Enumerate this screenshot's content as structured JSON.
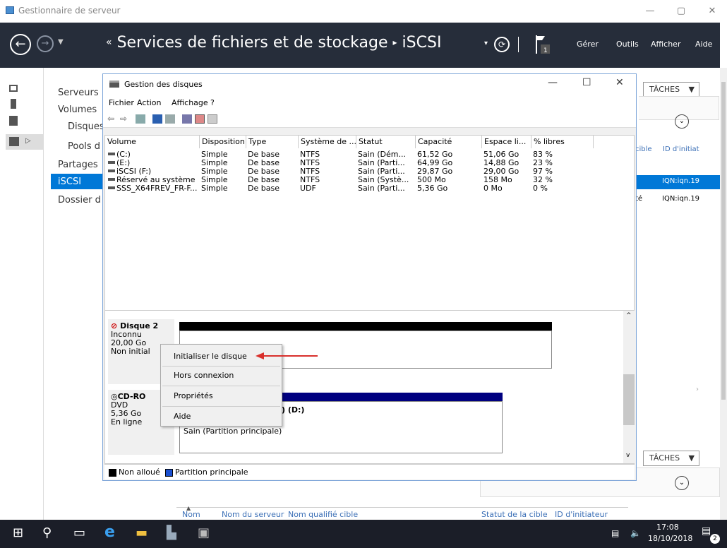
{
  "window": {
    "title": "Gestionnaire de serveur"
  },
  "header": {
    "breadcrumb_prefix": "«",
    "title": "Services de fichiers et de stockage",
    "sep": "▸",
    "page": "iSCSI",
    "menu": [
      "Gérer",
      "Outils",
      "Afficher",
      "Aide"
    ]
  },
  "nav": [
    "Serveurs",
    "Volumes",
    "Disques",
    "Pools d",
    "Partages",
    "iSCSI",
    "Dossier d"
  ],
  "right": {
    "taches": "TÂCHES",
    "col_cible": "cible",
    "col_initiateur": "ID d'initiat",
    "row1": "IQN:iqn.19",
    "row2_state": "té",
    "row2": "IQN:iqn.19"
  },
  "dm": {
    "title": "Gestion des disques",
    "menu": [
      "Fichier",
      "Action",
      "Affichage",
      "?"
    ],
    "columns": [
      "Volume",
      "Disposition",
      "Type",
      "Système de ...",
      "Statut",
      "Capacité",
      "Espace li...",
      "% libres"
    ],
    "rows": [
      [
        "(C:)",
        "Simple",
        "De base",
        "NTFS",
        "Sain (Dém...",
        "61,52 Go",
        "51,06 Go",
        "83 %"
      ],
      [
        "(E:)",
        "Simple",
        "De base",
        "NTFS",
        "Sain (Parti...",
        "64,99 Go",
        "14,88 Go",
        "23 %"
      ],
      [
        "iSCSI (F:)",
        "Simple",
        "De base",
        "NTFS",
        "Sain (Parti...",
        "29,87 Go",
        "29,00 Go",
        "97 %"
      ],
      [
        "Réservé au système",
        "Simple",
        "De base",
        "NTFS",
        "Sain (Systè...",
        "500 Mo",
        "158 Mo",
        "32 %"
      ],
      [
        "SSS_X64FREV_FR-F...",
        "Simple",
        "De base",
        "UDF",
        "Sain (Parti...",
        "5,36 Go",
        "0 Mo",
        "0 %"
      ]
    ],
    "disk2": {
      "name": "Disque 2",
      "l1": "Inconnu",
      "l2": "20,00 Go",
      "l3": "Non initial"
    },
    "cdrom": {
      "name": "CD-RO",
      "l1": "DVD",
      "l2": "5,36 Go",
      "l3": "En ligne",
      "vol": ") (D:)",
      "status": "Sain (Partition principale)"
    },
    "legend": [
      "Non alloué",
      "Partition principale"
    ]
  },
  "context_menu": [
    "Initialiser le disque",
    "Hors connexion",
    "Propriétés",
    "Aide"
  ],
  "bottom_cols": [
    "Nom",
    "Nom du serveur",
    "Nom qualifié cible",
    "Statut de la cible",
    "ID d'initiateur"
  ],
  "taskbar": {
    "time": "17:08",
    "date": "18/10/2018",
    "notif": "2"
  },
  "colors": {
    "header": "#262d3a",
    "accent": "#0078d7",
    "arrow": "#d9302c"
  }
}
